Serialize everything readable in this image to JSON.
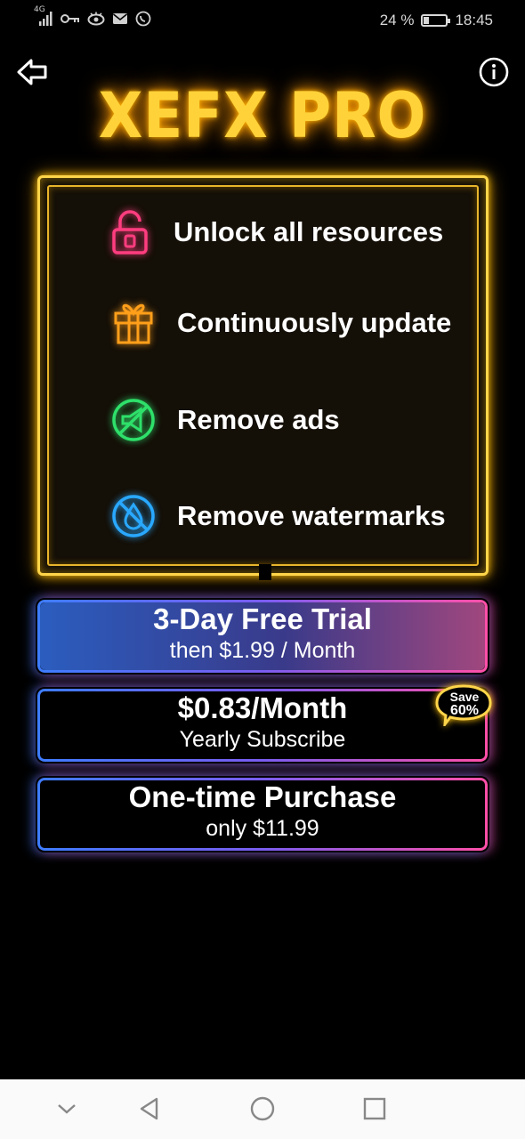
{
  "status_bar": {
    "network": "4G",
    "battery_percent_text": "24 %",
    "battery_level": 0.24,
    "time": "18:45"
  },
  "header": {
    "title": "XEFX PRO",
    "back_icon": "back-arrow-icon",
    "info_icon": "info-icon"
  },
  "features": [
    {
      "label": "Unlock all resources",
      "icon": "lock-icon",
      "color": "#ff3d7f"
    },
    {
      "label": "Continuously update",
      "icon": "gift-icon",
      "color": "#ff9f1a"
    },
    {
      "label": "Remove ads",
      "icon": "no-ads-icon",
      "color": "#2ee06a"
    },
    {
      "label": "Remove watermarks",
      "icon": "no-watermark-icon",
      "color": "#29a8ff"
    }
  ],
  "plans": [
    {
      "title": "3-Day Free Trial",
      "subtitle": "then $1.99 / Month",
      "selected": true
    },
    {
      "title": "$0.83/Month",
      "subtitle": "Yearly Subscribe",
      "selected": false
    },
    {
      "title": "One-time Purchase",
      "subtitle": "only $11.99",
      "selected": false
    }
  ],
  "badge": {
    "line1": "Save",
    "line2": "60%",
    "color": "#ffd54a"
  },
  "colors": {
    "title_neon": "#ffd23a",
    "frame_neon": "#ffd54a",
    "plan_gradient_start": "#3d7cff",
    "plan_gradient_end": "#ff4fa8",
    "background": "#000000"
  },
  "nav_bar": {
    "buttons": [
      "chevron-down-icon",
      "back-triangle-icon",
      "home-circle-icon",
      "recents-square-icon"
    ]
  }
}
